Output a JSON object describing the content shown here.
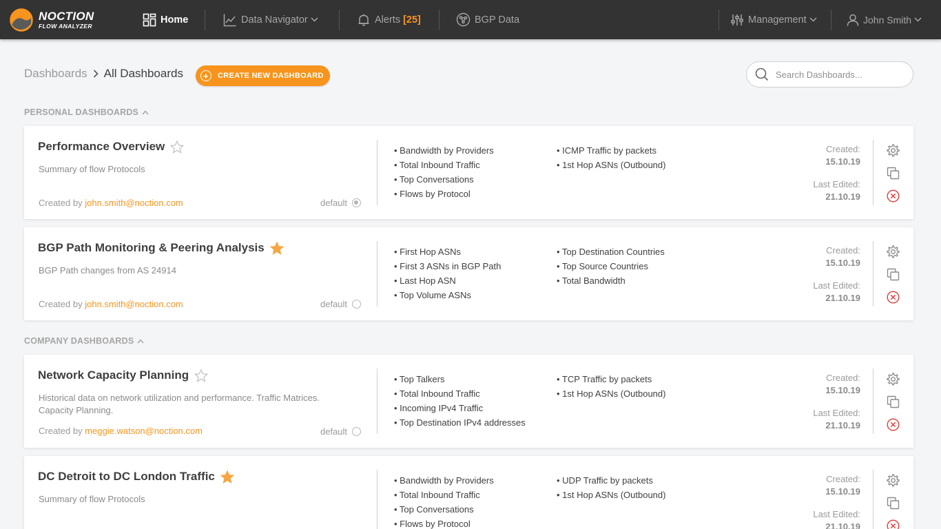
{
  "nav": {
    "brand_line1": "NOCTION",
    "brand_line2": "FLOW ANALYZER",
    "home": "Home",
    "data_navigator": "Data Navigator",
    "alerts": "Alerts",
    "alerts_count": "[25]",
    "bgp_data": "BGP Data",
    "management": "Management",
    "user": "John Smith"
  },
  "header": {
    "crumb_root": "Dashboards",
    "crumb_current": "All Dashboards",
    "create_label": "CREATE NEW DASHBOARD",
    "search_placeholder": "Search Dashboards..."
  },
  "sections": {
    "personal": "PERSONAL DASHBOARDS",
    "company": "COMPANY DASHBOARDS"
  },
  "labels": {
    "created_by": "Created by",
    "default": "default",
    "created": "Created:",
    "last_edited": "Last Edited:"
  },
  "cards": [
    {
      "title": "Performance Overview",
      "starred": false,
      "description": "Summary of flow Protocols",
      "creator": "john.smith@noction.com",
      "is_default": true,
      "widgets_col1": [
        "• Bandwidth by Providers",
        "• Total Inbound Traffic",
        "• Top Conversations",
        "• Flows by Protocol"
      ],
      "widgets_col2": [
        "• ICMP Traffic by packets",
        "• 1st Hop ASNs (Outbound)"
      ],
      "created": "15.10.19",
      "edited": "21.10.19"
    },
    {
      "title": "BGP Path Monitoring & Peering Analysis",
      "starred": true,
      "description": "BGP Path changes from AS 24914",
      "creator": "john.smith@noction.com",
      "is_default": false,
      "widgets_col1": [
        "• First Hop ASNs",
        "• First 3 ASNs in BGP Path",
        "• Last Hop ASN",
        "• Top Volume ASNs"
      ],
      "widgets_col2": [
        "• Top Destination Countries",
        "• Top Source Countries",
        "• Total Bandwidth"
      ],
      "created": "15.10.19",
      "edited": "21.10.19"
    },
    {
      "title": "Network Capacity Planning",
      "starred": false,
      "description": "Historical data on network utilization and performance. Traffic Matrices. Capacity Planning.",
      "creator": "meggie.watson@noction.com",
      "is_default": false,
      "widgets_col1": [
        "• Top Talkers",
        "• Total Inbound Traffic",
        "• Incoming IPv4 Traffic",
        "• Top Destination IPv4 addresses"
      ],
      "widgets_col2": [
        "• TCP Traffic by packets",
        "• 1st Hop ASNs (Outbound)"
      ],
      "created": "15.10.19",
      "edited": "21.10.19"
    },
    {
      "title": "DC Detroit to DC London Traffic",
      "starred": true,
      "description": "Summary of flow Protocols",
      "creator": "",
      "is_default": false,
      "widgets_col1": [
        "• Bandwidth by Providers",
        "• Total Inbound Traffic",
        "• Top Conversations",
        "• Flows by Protocol"
      ],
      "widgets_col2": [
        "• UDP Traffic by packets",
        "• 1st Hop ASNs (Outbound)"
      ],
      "created": "15.10.19",
      "edited": "21.10.19"
    }
  ],
  "colors": {
    "accent": "#f7941d",
    "topbar": "#333333",
    "delete": "#e04545",
    "star_off": "#c4c4c4"
  }
}
